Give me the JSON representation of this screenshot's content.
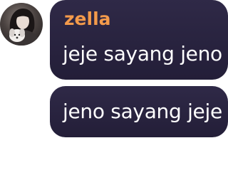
{
  "avatar": {
    "icon": "user-avatar-photo"
  },
  "messages": [
    {
      "sender": "zella",
      "text": "jeje sayang jeno"
    },
    {
      "text": "jeno sayang jeje"
    }
  ],
  "colors": {
    "bubble": "#2a2440",
    "sender_name": "#f39a4b",
    "text": "#ffffff"
  }
}
